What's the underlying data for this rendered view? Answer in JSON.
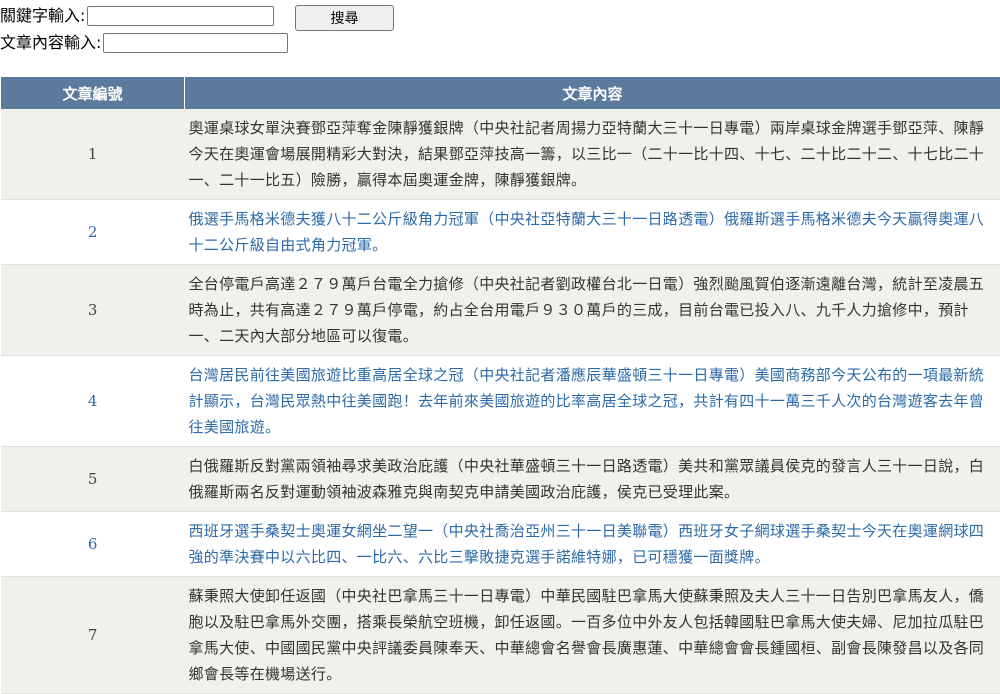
{
  "search": {
    "keyword_label": "關鍵字輸入:",
    "keyword_value": "",
    "content_label": "文章內容輸入:",
    "content_value": "",
    "button_label": "搜尋"
  },
  "table": {
    "headers": [
      "文章編號",
      "文章內容"
    ],
    "rows": [
      {
        "no": "1",
        "text": "奧運桌球女單決賽鄧亞萍奪金陳靜獲銀牌（中央社記者周揚力亞特蘭大三十一日專電）兩岸桌球金牌選手鄧亞萍、陳靜今天在奧運會場展開精彩大對決，結果鄧亞萍技高一籌，以三比一（二十一比十四、十七、二十比二十二、十七比二十一、二十一比五）險勝，贏得本屆奧運金牌，陳靜獲銀牌。"
      },
      {
        "no": "2",
        "text": "俄選手馬格米德夫獲八十二公斤級角力冠軍（中央社亞特蘭大三十一日路透電）俄羅斯選手馬格米德夫今天贏得奧運八十二公斤級自由式角力冠軍。"
      },
      {
        "no": "3",
        "text": "全台停電戶高達２７９萬戶台電全力搶修（中央社記者劉政權台北一日電）強烈颱風賀伯逐漸遠離台灣，統計至凌晨五時為止，共有高達２７９萬戶停電，約占全台用電戶９３０萬戶的三成，目前台電已投入八、九千人力搶修中，預計一、二天內大部分地區可以復電。"
      },
      {
        "no": "4",
        "text": "台灣居民前往美國旅遊比重高居全球之冠（中央社記者潘應辰華盛頓三十一日專電）美國商務部今天公布的一項最新統計顯示，台灣民眾熱中往美國跑！去年前來美國旅遊的比率高居全球之冠，共計有四十一萬三千人次的台灣遊客去年曾往美國旅遊。"
      },
      {
        "no": "5",
        "text": "白俄羅斯反對黨兩領袖尋求美政治庇護（中央社華盛頓三十一日路透電）美共和黨眾議員侯克的發言人三十一日說，白俄羅斯兩名反對運動領袖波森雅克與南契克申請美國政治庇護，侯克已受理此案。"
      },
      {
        "no": "6",
        "text": "西班牙選手桑契士奧運女網坐二望一（中央社喬治亞州三十一日美聯電）西班牙女子網球選手桑契士今天在奧運網球四強的準決賽中以六比四、一比六、六比三擊敗捷克選手諾維特娜，已可穩獲一面獎牌。"
      },
      {
        "no": "7",
        "text": "蘇秉照大使卸任返國（中央社巴拿馬三十一日專電）中華民國駐巴拿馬大使蘇秉照及夫人三十一日告別巴拿馬友人，僑胞以及駐巴拿馬外交團，搭乘長榮航空班機，卸任返國。一百多位中外友人包括韓國駐巴拿馬大使夫婦、尼加拉瓜駐巴拿馬大使、中國國民黨中央評議委員陳奉天、中華總會名譽會長廣惠蓮、中華總會會長鍾國桓、副會長陳發昌以及各同鄉會長等在機場送行。"
      }
    ]
  }
}
